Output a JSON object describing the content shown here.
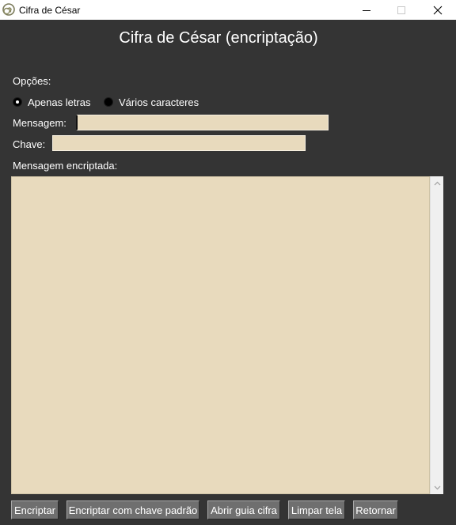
{
  "window": {
    "title": "Cifra de César",
    "icon": "spiral-icon",
    "controls": {
      "minimize": "minimize-icon",
      "maximize": "maximize-icon",
      "close": "close-icon"
    }
  },
  "header": {
    "title": "Cifra de César (encriptação)"
  },
  "options": {
    "label": "Opções:",
    "choices": [
      {
        "label": "Apenas letras",
        "selected": true
      },
      {
        "label": "Vários caracteres",
        "selected": false
      }
    ]
  },
  "form": {
    "message_label": "Mensagem:",
    "message_value": "",
    "key_label": "Chave:",
    "key_value": "",
    "encrypted_label": "Mensagem encriptada:",
    "encrypted_value": ""
  },
  "buttons": {
    "encrypt": "Encriptar",
    "encrypt_default_key": "Encriptar com chave padrão",
    "open_cipher_guide": "Abrir guia cifra",
    "clear_screen": "Limpar tela",
    "return": "Retornar"
  },
  "colors": {
    "background": "#343434",
    "field": "#e8dabd",
    "button": "#6f6f6f",
    "text": "#ffffff"
  }
}
